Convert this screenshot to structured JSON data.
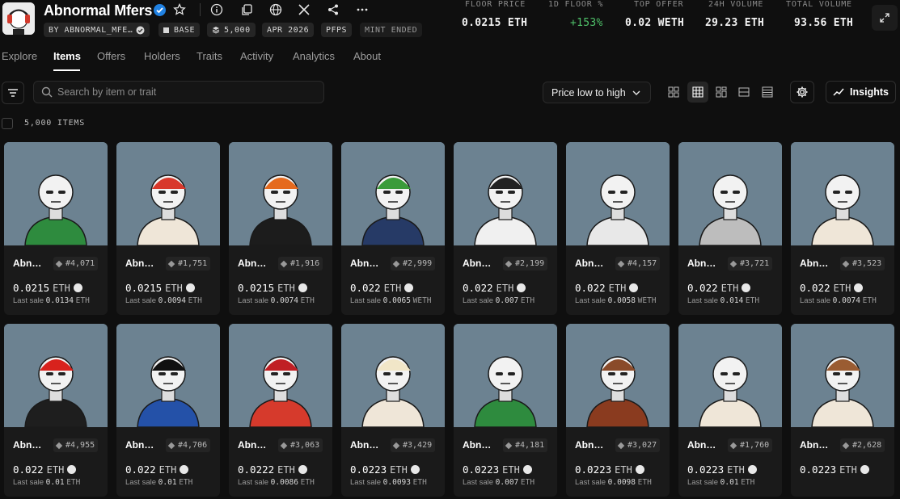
{
  "collection": {
    "name": "Abnormal Mfers",
    "pills": [
      "BY ABNORMAL_MFE…",
      "BASE",
      "5,000",
      "APR 2026",
      "PFPS",
      "MINT ENDED"
    ]
  },
  "stats": [
    {
      "label": "FLOOR PRICE",
      "value": "0.0215 ETH"
    },
    {
      "label": "1D FLOOR %",
      "value": "+153%"
    },
    {
      "label": "TOP OFFER",
      "value": "0.02 WETH"
    },
    {
      "label": "24H VOLUME",
      "value": "29.23 ETH"
    },
    {
      "label": "TOTAL VOLUME",
      "value": "93.56 ETH"
    }
  ],
  "tabs": [
    "Explore",
    "Items",
    "Offers",
    "Holders",
    "Traits",
    "Activity",
    "Analytics",
    "About"
  ],
  "active_tab": "Items",
  "search": {
    "placeholder": "Search by item or trait"
  },
  "sort": {
    "label": "Price low to high"
  },
  "insights_label": "Insights",
  "item_count": "5,000 ITEMS",
  "colors": {
    "accent_green": "#4fc16a",
    "verified_blue": "#2081e2",
    "card_bg": "#6c8291"
  },
  "items": [
    {
      "name": "Abn…",
      "id": "#4,071",
      "price": "0.0215",
      "unit": "ETH",
      "last_label": "Last sale",
      "last_value": "0.0134",
      "last_unit": "ETH"
    },
    {
      "name": "Abn…",
      "id": "#1,751",
      "price": "0.0215",
      "unit": "ETH",
      "last_label": "Last sale",
      "last_value": "0.0094",
      "last_unit": "ETH"
    },
    {
      "name": "Abn…",
      "id": "#1,916",
      "price": "0.0215",
      "unit": "ETH",
      "last_label": "Last sale",
      "last_value": "0.0074",
      "last_unit": "ETH"
    },
    {
      "name": "Abn…",
      "id": "#2,999",
      "price": "0.022",
      "unit": "ETH",
      "last_label": "Last sale",
      "last_value": "0.0065",
      "last_unit": "WETH"
    },
    {
      "name": "Abn…",
      "id": "#2,199",
      "price": "0.022",
      "unit": "ETH",
      "last_label": "Last sale",
      "last_value": "0.007",
      "last_unit": "ETH"
    },
    {
      "name": "Abn…",
      "id": "#4,157",
      "price": "0.022",
      "unit": "ETH",
      "last_label": "Last sale",
      "last_value": "0.0058",
      "last_unit": "WETH"
    },
    {
      "name": "Abn…",
      "id": "#3,721",
      "price": "0.022",
      "unit": "ETH",
      "last_label": "Last sale",
      "last_value": "0.014",
      "last_unit": "ETH"
    },
    {
      "name": "Abn…",
      "id": "#3,523",
      "price": "0.022",
      "unit": "ETH",
      "last_label": "Last sale",
      "last_value": "0.0074",
      "last_unit": "ETH"
    },
    {
      "name": "Abn…",
      "id": "#4,955",
      "price": "0.022",
      "unit": "ETH",
      "last_label": "Last sale",
      "last_value": "0.01",
      "last_unit": "ETH"
    },
    {
      "name": "Abn…",
      "id": "#4,706",
      "price": "0.022",
      "unit": "ETH",
      "last_label": "Last sale",
      "last_value": "0.01",
      "last_unit": "ETH"
    },
    {
      "name": "Abn…",
      "id": "#3,063",
      "price": "0.0222",
      "unit": "ETH",
      "last_label": "Last sale",
      "last_value": "0.0086",
      "last_unit": "ETH"
    },
    {
      "name": "Abn…",
      "id": "#3,429",
      "price": "0.0223",
      "unit": "ETH",
      "last_label": "Last sale",
      "last_value": "0.0093",
      "last_unit": "ETH"
    },
    {
      "name": "Abn…",
      "id": "#4,181",
      "price": "0.0223",
      "unit": "ETH",
      "last_label": "Last sale",
      "last_value": "0.007",
      "last_unit": "ETH"
    },
    {
      "name": "Abn…",
      "id": "#3,027",
      "price": "0.0223",
      "unit": "ETH",
      "last_label": "Last sale",
      "last_value": "0.0098",
      "last_unit": "ETH"
    },
    {
      "name": "Abn…",
      "id": "#1,760",
      "price": "0.0223",
      "unit": "ETH",
      "last_label": "Last sale",
      "last_value": "0.01",
      "last_unit": "ETH"
    },
    {
      "name": "Abn…",
      "id": "#2,628",
      "price": "0.0223",
      "unit": "ETH",
      "last_label": "",
      "last_value": "",
      "last_unit": ""
    }
  ]
}
